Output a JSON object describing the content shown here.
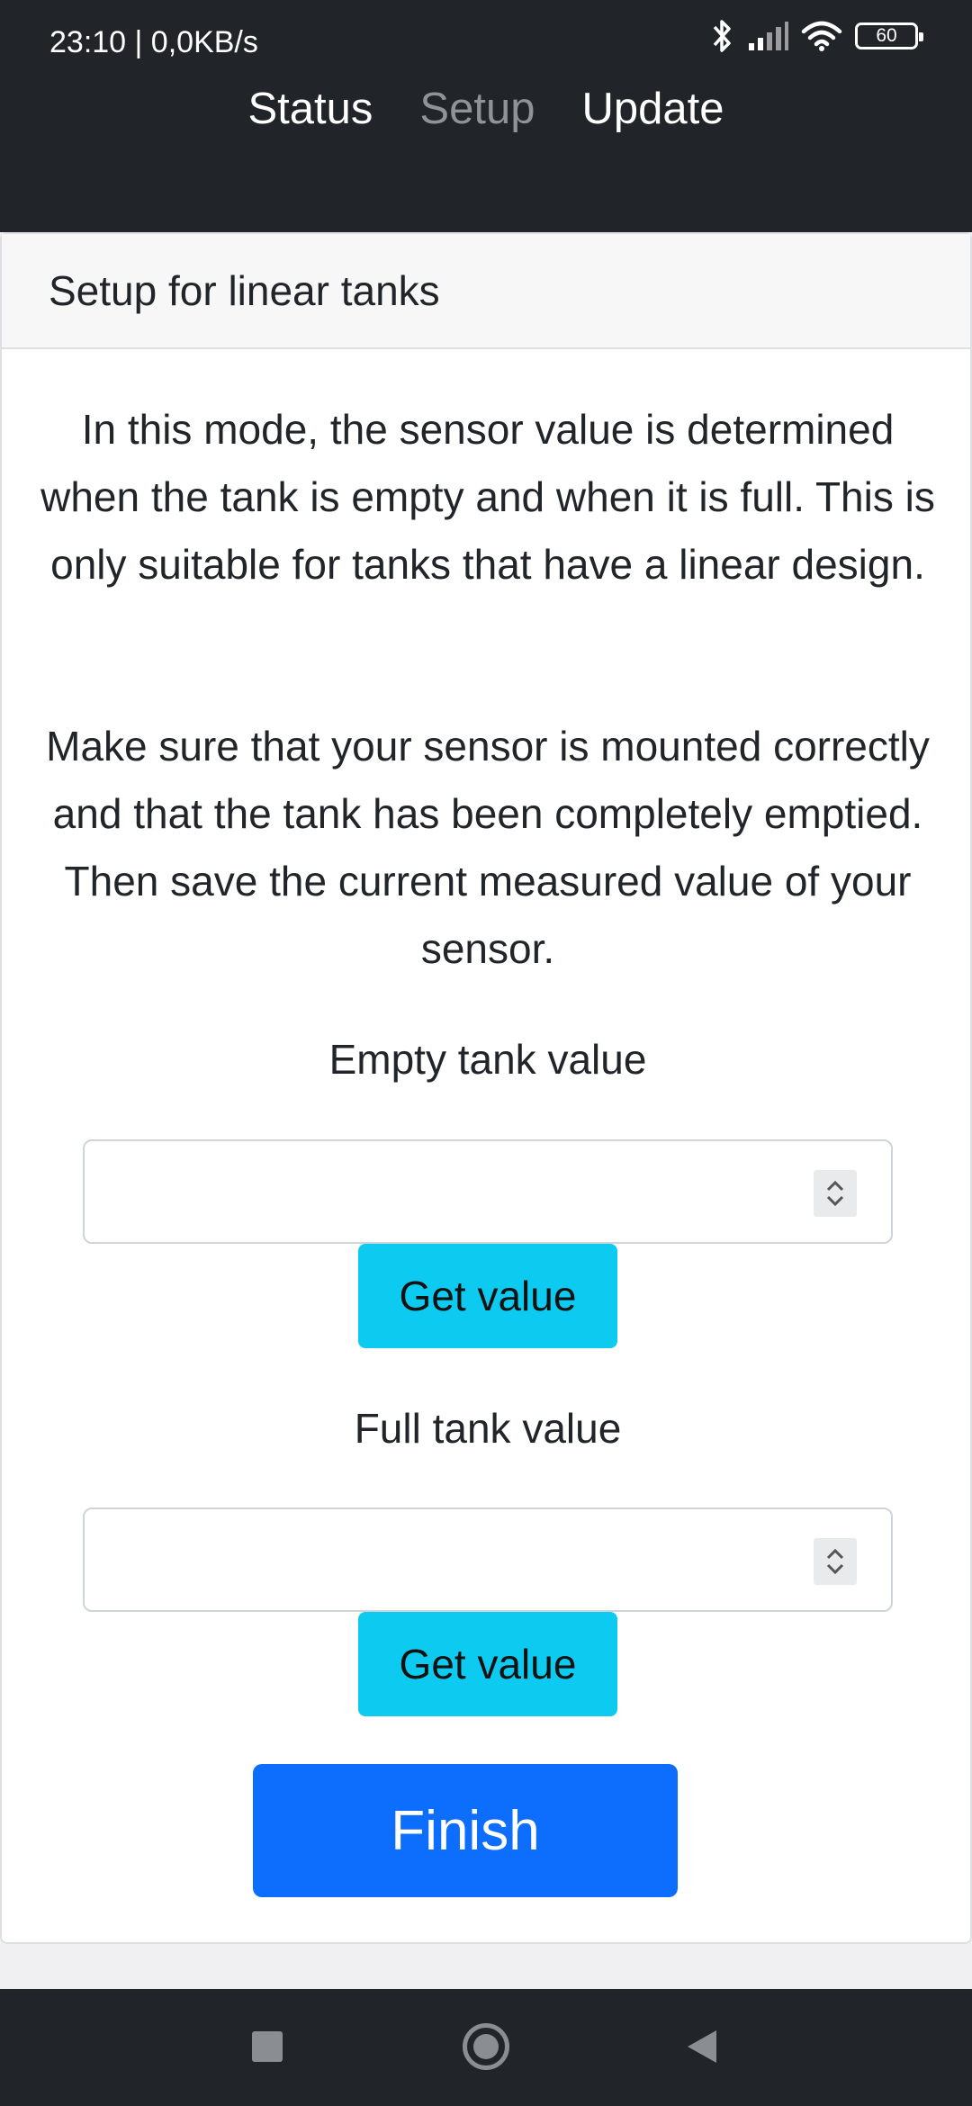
{
  "status_bar": {
    "time_speed": "23:10 | 0,0KB/s",
    "battery": "60",
    "icons": [
      "bluetooth-icon",
      "signal-icon",
      "wifi-icon",
      "battery-icon"
    ]
  },
  "nav": {
    "items": [
      {
        "label": "Status",
        "active": false
      },
      {
        "label": "Setup",
        "active": true
      },
      {
        "label": "Update",
        "active": false
      }
    ]
  },
  "card": {
    "header": "Setup for linear tanks",
    "paragraph1": "In this mode, the sensor value is determined when the tank is empty and when it is full. This is only suitable for tanks that have a linear design.",
    "paragraph2": "Make sure that your sensor is mounted correctly and that the tank has been completely emptied. Then save the current measured value of your sensor.",
    "empty_label": "Empty tank value",
    "empty_value": "",
    "empty_button": "Get value",
    "full_label": "Full tank value",
    "full_value": "",
    "full_button": "Get value",
    "finish_button": "Finish"
  },
  "system_nav": {
    "buttons": [
      "recents-icon",
      "home-icon",
      "back-icon"
    ]
  },
  "colors": {
    "navbar": "#212529",
    "info": "#0dcaf0",
    "primary": "#0d6efd"
  }
}
